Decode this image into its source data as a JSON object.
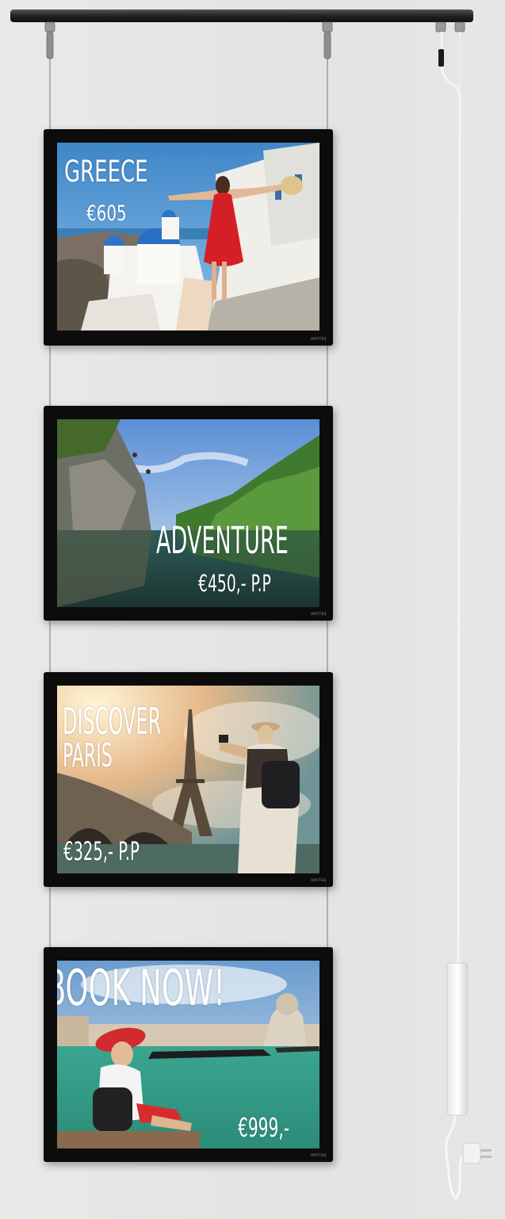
{
  "panels": [
    {
      "title": "GREECE",
      "price": "€605",
      "brand": "ARTITEQ"
    },
    {
      "title": "ADVENTURE",
      "price": "€450,- P.P",
      "brand": "ARTITEQ"
    },
    {
      "title_line1": "DISCOVER",
      "title_line2": "PARIS",
      "price": "€325,- P.P",
      "brand": "ARTITEQ"
    },
    {
      "title": "BOOK NOW!",
      "price": "€999,-",
      "brand": "ARTITEQ"
    }
  ]
}
